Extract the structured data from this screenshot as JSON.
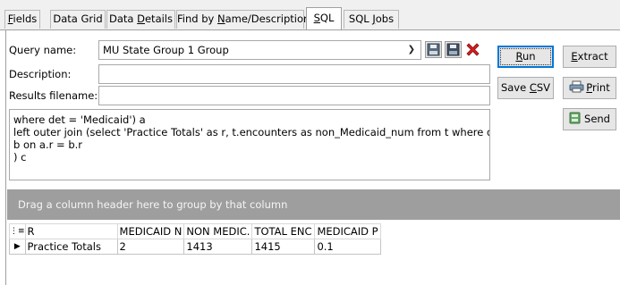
{
  "tabs": [
    {
      "prefix": "",
      "ul": "F",
      "suffix": "ields"
    },
    {
      "prefix": "Data Grid",
      "ul": "",
      "suffix": ""
    },
    {
      "prefix": "Data ",
      "ul": "D",
      "suffix": "etails"
    },
    {
      "prefix": "Find by ",
      "ul": "N",
      "suffix": "ame/Description"
    },
    {
      "prefix": "",
      "ul": "S",
      "suffix": "QL"
    },
    {
      "prefix": "SQL ",
      "ul": "J",
      "suffix": "obs"
    }
  ],
  "form": {
    "query_name_label": "Query name:",
    "query_name_value": "MU State Group 1 Group",
    "description_label": "Description:",
    "description_value": "",
    "results_filename_label": "Results filename:",
    "results_filename_value": ""
  },
  "buttons": {
    "run": {
      "prefix": "",
      "ul": "R",
      "suffix": "un"
    },
    "extract": {
      "prefix": "",
      "ul": "E",
      "suffix": "xtract"
    },
    "save_csv": {
      "prefix": "Save ",
      "ul": "C",
      "suffix": "SV"
    },
    "print": {
      "prefix": "",
      "ul": "P",
      "suffix": "rint"
    },
    "send": "Send"
  },
  "icons": {
    "save": "save-icon",
    "save_as": "save-as-icon",
    "delete": "delete-icon",
    "print": "printer-icon",
    "send": "send-icon"
  },
  "colors": {
    "delete_icon": "#d42020",
    "group_bar": "#9e9e9e",
    "focus_border": "#0078d7"
  },
  "sql_lines": [
    "where det = 'Medicaid') a",
    "left outer join (select 'Practice Totals' as r, t.encounters as non_Medicaid_num from t where det = 'not Medicaid')",
    "b on a.r = b.r",
    ") c"
  ],
  "group_bar_text": "Drag a column header here to group by that column",
  "grid": {
    "columns": [
      "R",
      "MEDICAID N",
      "NON MEDIC.",
      "TOTAL ENC",
      "MEDICAID P"
    ],
    "rows": [
      [
        "Practice Totals",
        "2",
        "1413",
        "1415",
        "0.1"
      ]
    ]
  }
}
